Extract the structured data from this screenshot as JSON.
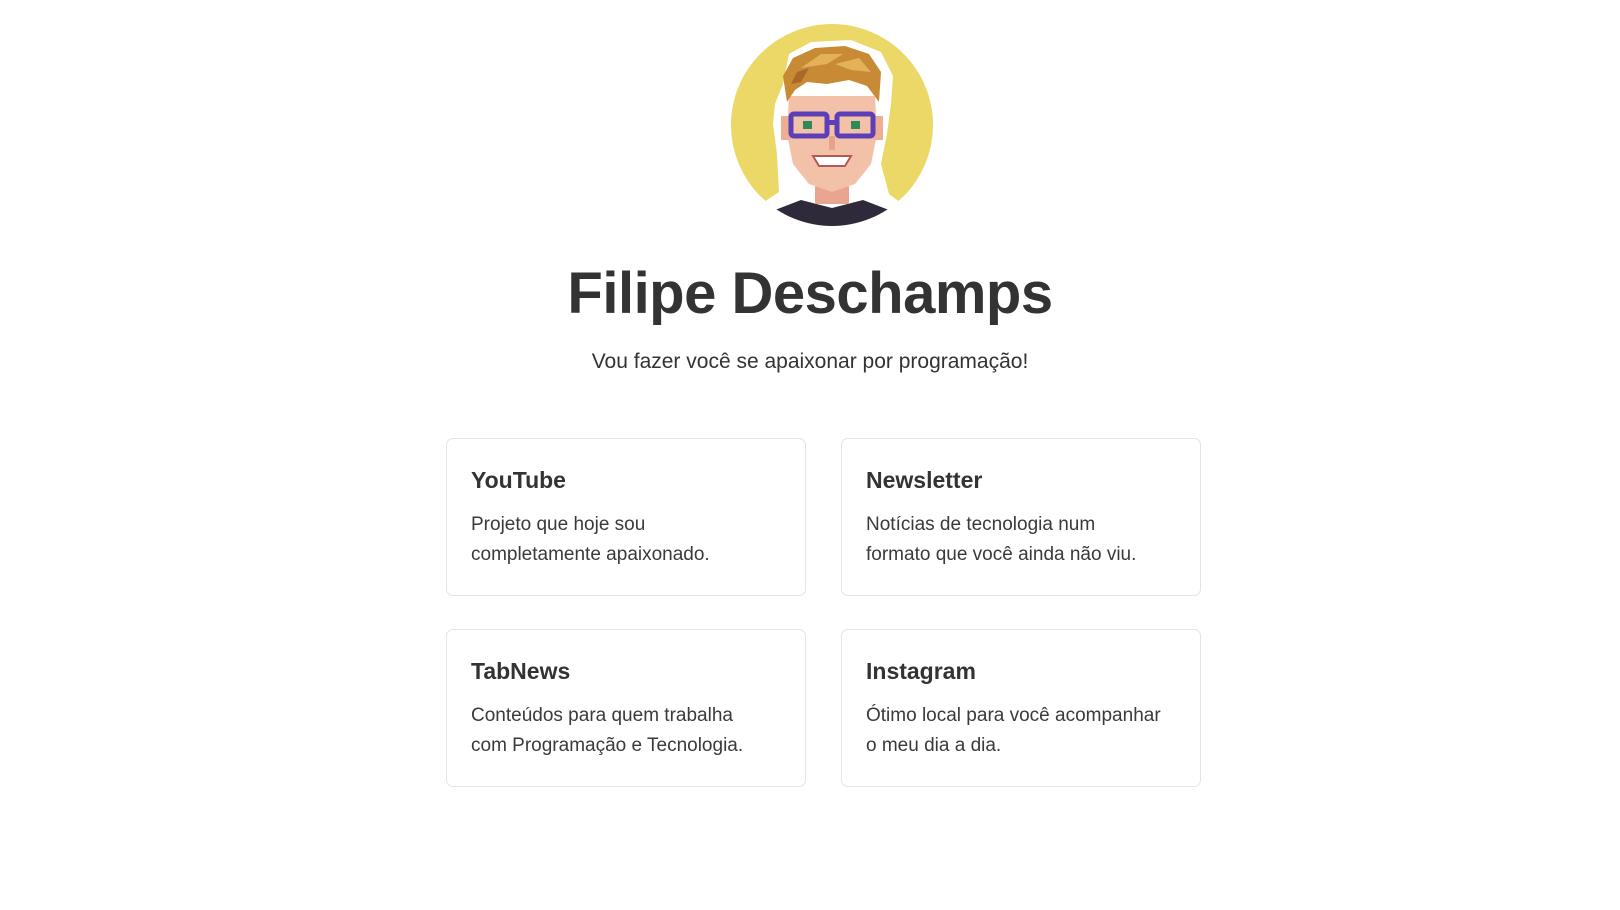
{
  "profile": {
    "name": "Filipe Deschamps",
    "tagline": "Vou fazer você se apaixonar por programação!",
    "avatar_icon": "pixel-art-avatar",
    "avatar_bg": "#ecd867"
  },
  "links": [
    {
      "title": "YouTube",
      "description_line1": "Projeto que hoje sou",
      "description_line2": "completamente apaixonado."
    },
    {
      "title": "Newsletter",
      "description_line1": "Notícias de tecnologia num",
      "description_line2": "formato que você ainda não viu."
    },
    {
      "title": "TabNews",
      "description_line1": "Conteúdos para quem trabalha",
      "description_line2": "com Programação e Tecnologia."
    },
    {
      "title": "Instagram",
      "description_line1": "Ótimo local para você acompanhar",
      "description_line2": "o meu dia a dia."
    }
  ]
}
